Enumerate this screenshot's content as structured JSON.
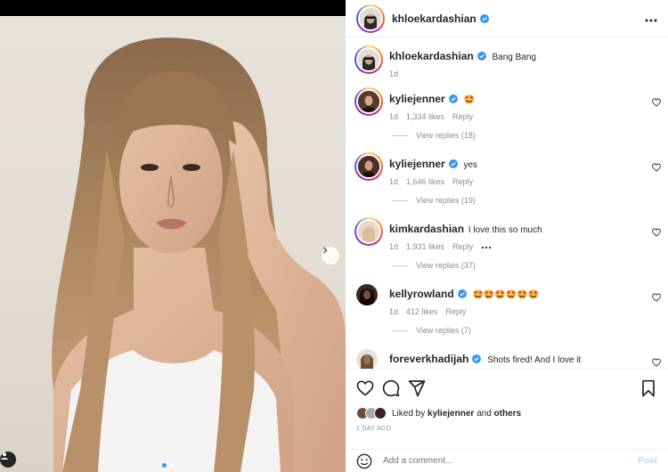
{
  "post": {
    "author": "khloekardashian",
    "caption": "Bang Bang",
    "caption_age": "1d",
    "likes_prefix": "Liked by",
    "likes_user": "kyliejenner",
    "likes_and": "and",
    "likes_others": "others",
    "date": "1 DAY AGO",
    "carousel_total": 2,
    "carousel_index": 1
  },
  "comments": [
    {
      "user": "kyliejenner",
      "verified": true,
      "text": "🤩",
      "age": "1d",
      "likes": "1,334 likes",
      "reply": "Reply",
      "view_replies": "View replies (18)",
      "avatar_color": "#4a2e25"
    },
    {
      "user": "kyliejenner",
      "verified": true,
      "text": "yes",
      "age": "1d",
      "likes": "1,646 likes",
      "reply": "Reply",
      "view_replies": "View replies (19)",
      "avatar_color": "#3a2520"
    },
    {
      "user": "kimkardashian",
      "verified": false,
      "text": "I love this so much",
      "age": "1d",
      "likes": "1,931 likes",
      "reply": "Reply",
      "view_replies": "View replies (37)",
      "avatar_color": "#d9c6b0"
    },
    {
      "user": "kellyrowland",
      "verified": true,
      "text": "🤩🤩🤩🤩🤩🤩",
      "age": "1d",
      "likes": "412 likes",
      "reply": "Reply",
      "view_replies": "View replies (7)",
      "avatar_color": "#2b1a14"
    },
    {
      "user": "foreverkhadijah",
      "verified": true,
      "text": "Shots fired! And I love it",
      "age": "",
      "likes": "",
      "reply": "",
      "view_replies": "",
      "avatar_color": "#6b4d3a"
    }
  ],
  "composer": {
    "placeholder": "Add a comment...",
    "post_label": "Post"
  },
  "colors": {
    "verified": "#3797f0",
    "post_disabled": "#b2dffc",
    "muted": "#8e8e8e"
  },
  "icons": [
    "heart-icon",
    "comment-icon",
    "share-icon",
    "bookmark-icon",
    "emoji-icon",
    "more-icon",
    "chevron-right-icon",
    "verified-icon",
    "user-tag-icon"
  ]
}
